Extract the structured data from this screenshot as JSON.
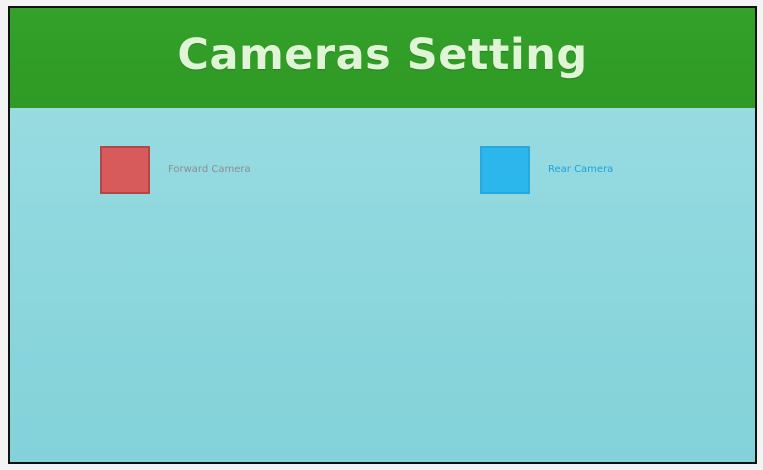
{
  "header": {
    "title": "Cameras Setting"
  },
  "options": [
    {
      "label": "Forward Camera",
      "color": "#d85b5b"
    },
    {
      "label": "Rear Camera",
      "color": "#2cb7ec"
    }
  ]
}
